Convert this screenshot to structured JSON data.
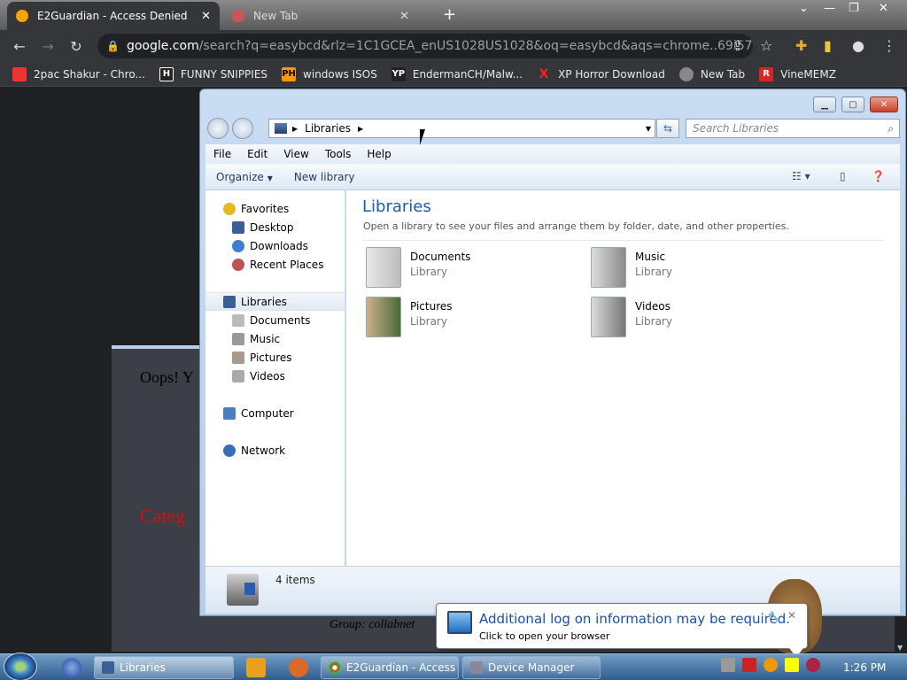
{
  "browser": {
    "tabs": [
      {
        "title": "E2Guardian - Access Denied",
        "active": true
      },
      {
        "title": "New Tab",
        "active": false
      }
    ],
    "url_domain": "google.com",
    "url_path": "/search?q=easybcd&rlz=1C1GCEA_enUS1028US1028&oq=easybcd&aqs=chrome..69i57.1764j0...",
    "bookmarks": [
      {
        "label": "2pac Shakur - Chro...",
        "icon": "youtube-icon",
        "color": "#e33"
      },
      {
        "label": "FUNNY SNIPPIES",
        "icon": "H",
        "color": "#222"
      },
      {
        "label": "windows ISOS",
        "icon": "PH",
        "color": "#f90"
      },
      {
        "label": "EndermanCH/Malw...",
        "icon": "YP",
        "color": "#222"
      },
      {
        "label": "XP Horror Download",
        "icon": "X",
        "color": "#e22"
      },
      {
        "label": "New Tab",
        "icon": "globe-icon",
        "color": "#888"
      },
      {
        "label": "VineMEMZ",
        "icon": "R",
        "color": "#d22"
      }
    ]
  },
  "page": {
    "oops": "Oops! Y",
    "category": "Categ",
    "group": "Group: collabnet"
  },
  "explorer": {
    "breadcrumb": "Libraries",
    "search_placeholder": "Search Libraries",
    "menu": [
      "File",
      "Edit",
      "View",
      "Tools",
      "Help"
    ],
    "commands": {
      "organize": "Organize",
      "new_library": "New library"
    },
    "nav": {
      "favorites": "Favorites",
      "desktop": "Desktop",
      "downloads": "Downloads",
      "recent_places": "Recent Places",
      "libraries": "Libraries",
      "documents": "Documents",
      "music": "Music",
      "pictures": "Pictures",
      "videos": "Videos",
      "computer": "Computer",
      "network": "Network"
    },
    "heading": "Libraries",
    "subheading": "Open a library to see your files and arrange them by folder, date, and other properties.",
    "libraries": [
      {
        "name": "Documents",
        "type": "Library"
      },
      {
        "name": "Music",
        "type": "Library"
      },
      {
        "name": "Pictures",
        "type": "Library"
      },
      {
        "name": "Videos",
        "type": "Library"
      }
    ],
    "item_count": "4 items"
  },
  "balloon": {
    "title": "Additional log on information may be required.",
    "subtitle": "Click to open your browser"
  },
  "taskbar": {
    "tasks": [
      "Libraries",
      "E2Guardian - Access ...",
      "Device Manager"
    ],
    "clock": "1:26 PM"
  }
}
